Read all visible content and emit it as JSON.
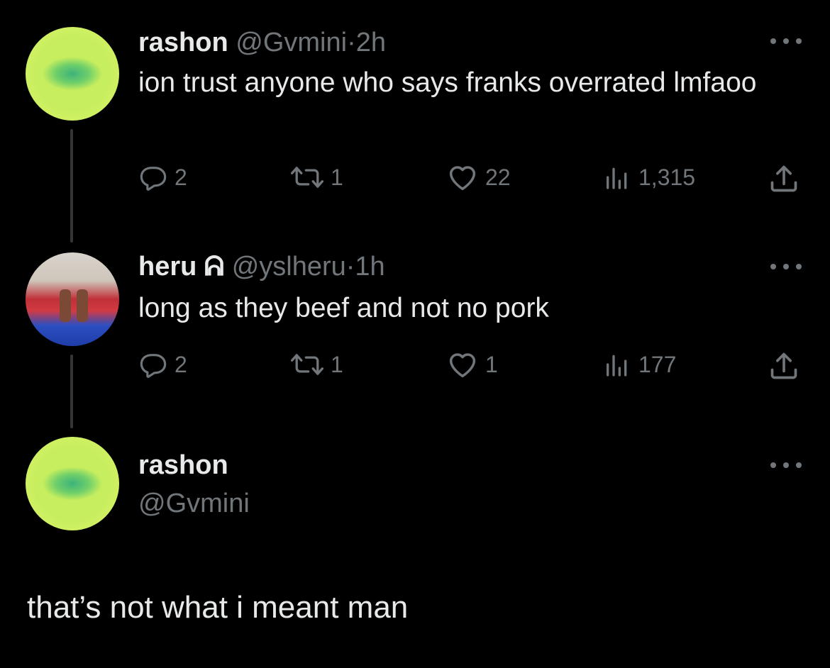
{
  "tweets": [
    {
      "name": "rashon",
      "handle": "@Gvmini",
      "separator": "·",
      "time": "2h",
      "text": "ion trust anyone who says franks overrated lmfaoo",
      "replies": "2",
      "retweets": "1",
      "likes": "22",
      "views": "1,315"
    },
    {
      "name": "heru",
      "name_symbol": "ᕱ",
      "handle": "@yslheru",
      "separator": "·",
      "time": "1h",
      "text": "long as they beef and not no pork",
      "replies": "2",
      "retweets": "1",
      "likes": "1",
      "views": "177"
    }
  ],
  "main_tweet": {
    "name": "rashon",
    "handle": "@Gvmini",
    "text": "that’s not what i meant man"
  },
  "icons": {
    "reply": "reply-bubble-icon",
    "retweet": "retweet-icon",
    "like": "heart-icon",
    "views": "views-bar-chart-icon",
    "share": "share-upload-icon",
    "more": "more-dots-icon"
  },
  "colors": {
    "background": "#000000",
    "text": "#e7e9ea",
    "muted": "#71767b",
    "thread_line": "#333639"
  }
}
